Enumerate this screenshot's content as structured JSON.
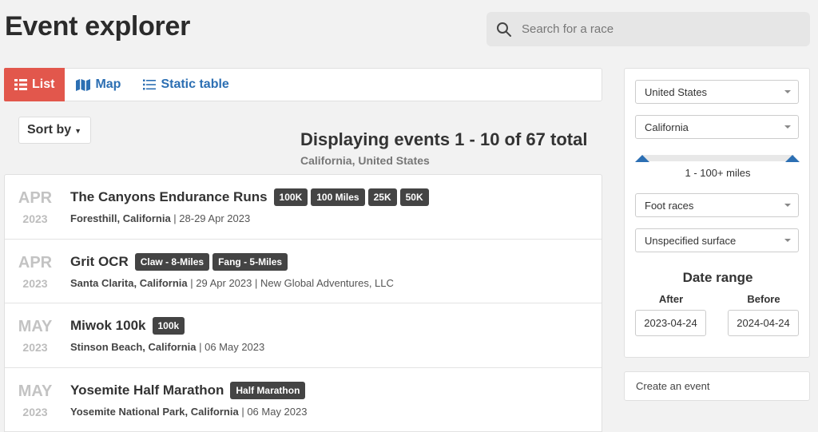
{
  "header": {
    "title": "Event explorer",
    "search_placeholder": "Search for a race"
  },
  "tabs": [
    {
      "label": "List",
      "icon": "list-icon",
      "active": true
    },
    {
      "label": "Map",
      "icon": "map-icon",
      "active": false
    },
    {
      "label": "Static table",
      "icon": "table-list-icon",
      "active": false
    }
  ],
  "sort": {
    "label": "Sort by"
  },
  "display": {
    "heading": "Displaying events 1 - 10 of 67 total",
    "location": "California, United States"
  },
  "events": [
    {
      "month": "APR",
      "year": "2023",
      "name": "The Canyons Endurance Runs",
      "badges": [
        "100K",
        "100 Miles",
        "25K",
        "50K"
      ],
      "location": "Foresthill, California",
      "details": " | 28-29 Apr 2023"
    },
    {
      "month": "APR",
      "year": "2023",
      "name": "Grit OCR",
      "badges": [
        "Claw - 8-Miles",
        "Fang - 5-Miles"
      ],
      "location": "Santa Clarita, California",
      "details": " | 29 Apr 2023 | New Global Adventures, LLC"
    },
    {
      "month": "MAY",
      "year": "2023",
      "name": "Miwok 100k",
      "badges": [
        "100k"
      ],
      "location": "Stinson Beach, California",
      "details": " | 06 May 2023"
    },
    {
      "month": "MAY",
      "year": "2023",
      "name": "Yosemite Half Marathon",
      "badges": [
        "Half Marathon"
      ],
      "location": "Yosemite National Park, California",
      "details": " | 06 May 2023"
    }
  ],
  "filters": {
    "country": "United States",
    "state": "California",
    "distance_label": "1 - 100+ miles",
    "race_type": "Foot races",
    "surface": "Unspecified surface",
    "date_range_title": "Date range",
    "after_label": "After",
    "after_value": "2023-04-24",
    "before_label": "Before",
    "before_value": "2024-04-24"
  },
  "create": {
    "label": "Create an event"
  },
  "colors": {
    "accent": "#e2574c",
    "link": "#2c6fb3",
    "badge": "#444444"
  }
}
